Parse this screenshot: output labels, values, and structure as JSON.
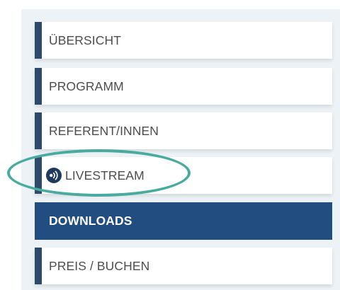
{
  "nav": {
    "items": [
      {
        "label": "ÜBERSICHT"
      },
      {
        "label": "PROGRAMM"
      },
      {
        "label": "REFERENT/INNEN"
      },
      {
        "label": "LIVESTREAM",
        "icon": "livestream-icon"
      },
      {
        "label": "DOWNLOADS",
        "active": true
      },
      {
        "label": "PREIS / BUCHEN"
      }
    ]
  },
  "colors": {
    "accent": "#2c4b6c",
    "active_bg": "#214d80",
    "highlight": "#48ab9e",
    "panel_bg": "#ecf2f6"
  }
}
